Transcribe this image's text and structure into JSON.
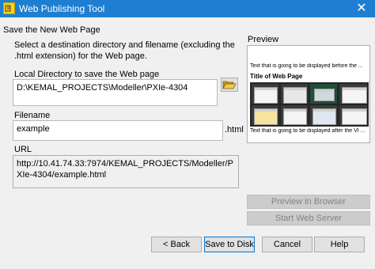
{
  "window": {
    "title": "Web Publishing Tool",
    "close_glyph": "✕"
  },
  "section_title": "Save the New Web Page",
  "instructions": "Select a destination directory and filename (excluding the .html extension) for the Web page.",
  "local_dir": {
    "label": "Local Directory to save the Web page",
    "value": "D:\\KEMAL_PROJECTS\\Modeller\\PXIe-4304",
    "browse_icon": "folder-open-icon"
  },
  "filename": {
    "label": "Filename",
    "value": "example",
    "suffix": ".html"
  },
  "url": {
    "label": "URL",
    "value": "http://10.41.74.33:7974/KEMAL_PROJECTS/Modeller/PXIe-4304/example.html"
  },
  "preview": {
    "label": "Preview",
    "text_before": "Text that is going to be displayed before the ...",
    "page_title": "Title of Web Page",
    "text_after": "Text that is going to be displayed after the VI ..."
  },
  "buttons": {
    "preview_in_browser": "Preview in Browser",
    "start_web_server": "Start Web Server",
    "back": "< Back",
    "save_to_disk": "Save to Disk",
    "cancel": "Cancel",
    "help": "Help"
  },
  "colors": {
    "titlebar": "#1e7fd2",
    "accent_border": "#0078d7",
    "folder": "#e8b838"
  }
}
